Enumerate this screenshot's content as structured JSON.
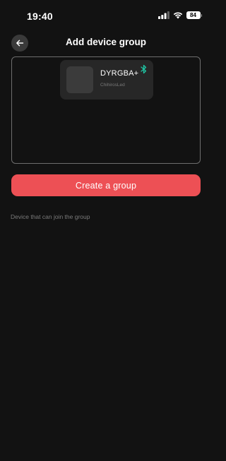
{
  "status_bar": {
    "time": "19:40",
    "battery": "84",
    "icons": [
      "cellular-signal-icon",
      "wifi-icon",
      "battery-icon"
    ]
  },
  "header": {
    "back_icon": "arrow-left-icon",
    "title": "Add device group"
  },
  "group": {
    "devices": [
      {
        "name": "DYRGBA+",
        "brand": "ChihirosLed",
        "connection_icon": "bluetooth-icon",
        "connection_color": "#1fc3a2"
      }
    ]
  },
  "create_button": {
    "label": "Create a group",
    "color": "#ed5055"
  },
  "available_section": {
    "label": "Device that can join the group"
  }
}
